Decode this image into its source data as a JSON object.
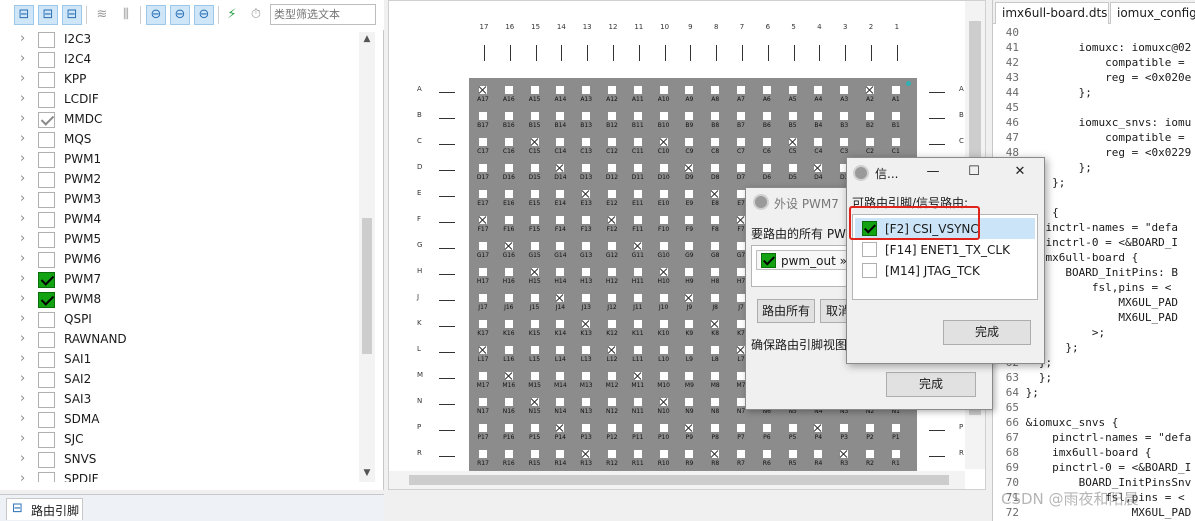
{
  "toolbar": {
    "filter_placeholder": "类型筛选文本"
  },
  "peripherals": [
    {
      "name": "I2C3",
      "state": "unchecked"
    },
    {
      "name": "I2C4",
      "state": "unchecked"
    },
    {
      "name": "KPP",
      "state": "unchecked"
    },
    {
      "name": "LCDIF",
      "state": "unchecked"
    },
    {
      "name": "MMDC",
      "state": "grey"
    },
    {
      "name": "MQS",
      "state": "unchecked"
    },
    {
      "name": "PWM1",
      "state": "unchecked"
    },
    {
      "name": "PWM2",
      "state": "unchecked"
    },
    {
      "name": "PWM3",
      "state": "unchecked"
    },
    {
      "name": "PWM4",
      "state": "unchecked"
    },
    {
      "name": "PWM5",
      "state": "unchecked"
    },
    {
      "name": "PWM6",
      "state": "unchecked"
    },
    {
      "name": "PWM7",
      "state": "checked"
    },
    {
      "name": "PWM8",
      "state": "checked"
    },
    {
      "name": "QSPI",
      "state": "unchecked"
    },
    {
      "name": "RAWNAND",
      "state": "unchecked"
    },
    {
      "name": "SAI1",
      "state": "unchecked"
    },
    {
      "name": "SAI2",
      "state": "unchecked"
    },
    {
      "name": "SAI3",
      "state": "unchecked"
    },
    {
      "name": "SDMA",
      "state": "unchecked"
    },
    {
      "name": "SJC",
      "state": "unchecked"
    },
    {
      "name": "SNVS",
      "state": "unchecked"
    },
    {
      "name": "SPDIF",
      "state": "unchecked"
    }
  ],
  "bottom_tab": {
    "label": "路由引脚"
  },
  "package": {
    "columns": [
      "17",
      "16",
      "15",
      "14",
      "13",
      "12",
      "11",
      "10",
      "9",
      "8",
      "7",
      "6",
      "5",
      "4",
      "3",
      "2",
      "1"
    ],
    "rows": [
      "A",
      "B",
      "C",
      "D",
      "E",
      "F",
      "G",
      "H",
      "J",
      "K",
      "L",
      "M",
      "N",
      "P",
      "R"
    ]
  },
  "editor": {
    "tabs": [
      "imx6ull-board.dtsi",
      "iomux_config.c"
    ],
    "lines": [
      {
        "n": "40",
        "t": ""
      },
      {
        "n": "41",
        "t": "        iomuxc: iomuxc@02"
      },
      {
        "n": "42",
        "t": "            compatible ="
      },
      {
        "n": "43",
        "t": "            reg = <0x020e"
      },
      {
        "n": "44",
        "t": "        };"
      },
      {
        "n": "45",
        "t": ""
      },
      {
        "n": "46",
        "t": "        iomuxc_snvs: iomu"
      },
      {
        "n": "47",
        "t": "            compatible ="
      },
      {
        "n": "48",
        "t": "            reg = <0x0229"
      },
      {
        "n": "49",
        "t": "        };"
      },
      {
        "n": "50",
        "t": "    };"
      },
      {
        "n": "51",
        "t": ""
      },
      {
        "n": "52",
        "t": "uxc {"
      },
      {
        "n": "53",
        "t": "  pinctrl-names = \"defa"
      },
      {
        "n": "54",
        "t": "  pinctrl-0 = <&BOARD_I"
      },
      {
        "n": "55",
        "t": "  imx6ull-board {"
      },
      {
        "n": "56",
        "t": "      BOARD_InitPins: B"
      },
      {
        "n": "57",
        "t": "          fsl,pins = <"
      },
      {
        "n": "58",
        "t": "              MX6UL_PAD"
      },
      {
        "n": "59",
        "t": "              MX6UL_PAD"
      },
      {
        "n": "60",
        "t": "          >;"
      },
      {
        "n": "61",
        "t": "      };"
      },
      {
        "n": "62",
        "t": "  };"
      },
      {
        "n": "63",
        "t": "  };"
      },
      {
        "n": "64",
        "t": "};"
      },
      {
        "n": "65",
        "t": ""
      },
      {
        "n": "66",
        "t": "&iomuxc_snvs {"
      },
      {
        "n": "67",
        "t": "    pinctrl-names = \"defa"
      },
      {
        "n": "68",
        "t": "    imx6ull-board {"
      },
      {
        "n": "69",
        "t": "    pinctrl-0 = <&BOARD_I"
      },
      {
        "n": "70",
        "t": "        BOARD_InitPinsSnv"
      },
      {
        "n": "71",
        "t": "            fsl,pins = <"
      },
      {
        "n": "72",
        "t": "                MX6UL_PAD"
      }
    ],
    "watermark": "CSDN @雨夜和阳晨"
  },
  "dialog_pwm7": {
    "title": "外设 PWM7",
    "subtitle": "要路由的所有 PWM",
    "item": "pwm_out »",
    "route_all_button": "路由所有",
    "cancel_button": "取消",
    "note": "确保路由引脚视图",
    "done_button": "完成"
  },
  "dialog_route": {
    "title": "信...",
    "subtitle": "可路由引脚/信号路由:",
    "options": [
      {
        "label": "[F2] CSI_VSYNC",
        "checked": true
      },
      {
        "label": "[F14] ENET1_TX_CLK",
        "checked": false
      },
      {
        "label": "[M14] JTAG_TCK",
        "checked": false
      }
    ],
    "done_button": "完成"
  },
  "colors": {
    "accent": "#2a6fb5",
    "check_green": "#12a212",
    "highlight_red": "#e0241b",
    "package_grey": "#8c8c8c"
  }
}
